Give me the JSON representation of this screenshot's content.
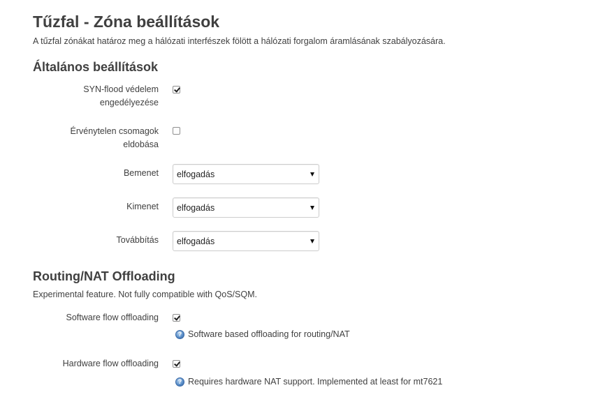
{
  "header": {
    "title": "Tűzfal - Zóna beállítások",
    "description": "A tűzfal zónákat határoz meg a hálózati interfészek fölött a hálózati forgalom áramlásának szabályozására."
  },
  "general": {
    "heading": "Általános beállítások",
    "syn_flood": {
      "label_line1": "SYN-flood védelem",
      "label_line2": "engedélyezése",
      "checked": true
    },
    "drop_invalid": {
      "label_line1": "Érvénytelen csomagok",
      "label_line2": "eldobása",
      "checked": false
    },
    "input": {
      "label": "Bemenet",
      "value": "elfogadás"
    },
    "output": {
      "label": "Kimenet",
      "value": "elfogadás"
    },
    "forward": {
      "label": "Továbbítás",
      "value": "elfogadás"
    }
  },
  "offloading": {
    "heading": "Routing/NAT Offloading",
    "description": "Experimental feature. Not fully compatible with QoS/SQM.",
    "software": {
      "label": "Software flow offloading",
      "checked": true,
      "hint": "Software based offloading for routing/NAT"
    },
    "hardware": {
      "label": "Hardware flow offloading",
      "checked": true,
      "hint": "Requires hardware NAT support. Implemented at least for mt7621"
    }
  }
}
